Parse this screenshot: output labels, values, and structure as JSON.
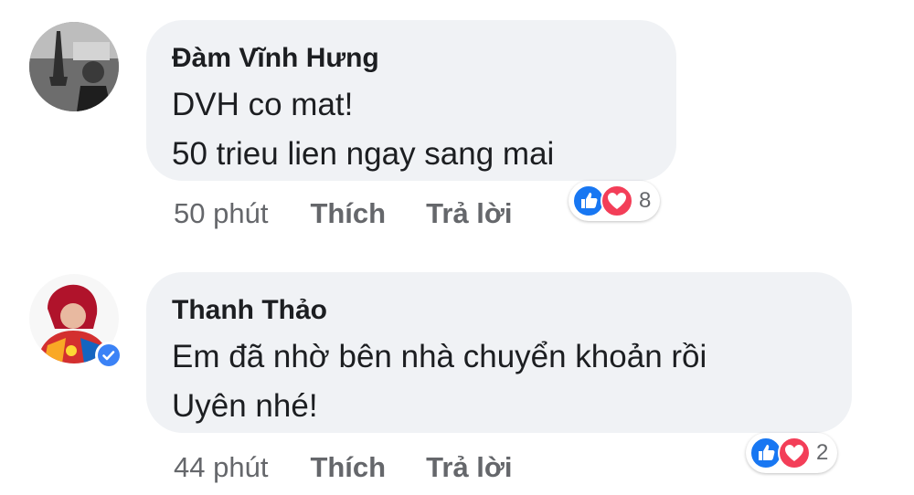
{
  "comments": [
    {
      "author": "Đàm Vĩnh Hưng",
      "lines": [
        "DVH co mat!",
        "50 trieu lien ngay sang mai"
      ],
      "time": "50 phút",
      "like_label": "Thích",
      "reply_label": "Trả lời",
      "reaction_count": "8",
      "reactions": [
        "like-icon",
        "love-icon"
      ],
      "verified": false
    },
    {
      "author": "Thanh Thảo",
      "lines": [
        "Em đã nhờ bên nhà chuyển khoản rồi",
        "Uyên nhé!"
      ],
      "time": "44 phút",
      "like_label": "Thích",
      "reply_label": "Trả lời",
      "reaction_count": "2",
      "reactions": [
        "like-icon",
        "love-icon"
      ],
      "verified": true
    }
  ],
  "colors": {
    "bubble": "#f0f2f5",
    "meta_text": "#65676b",
    "like_blue": "#1877f2",
    "love_red": "#f33e58",
    "verified_blue": "#3b82f6"
  }
}
